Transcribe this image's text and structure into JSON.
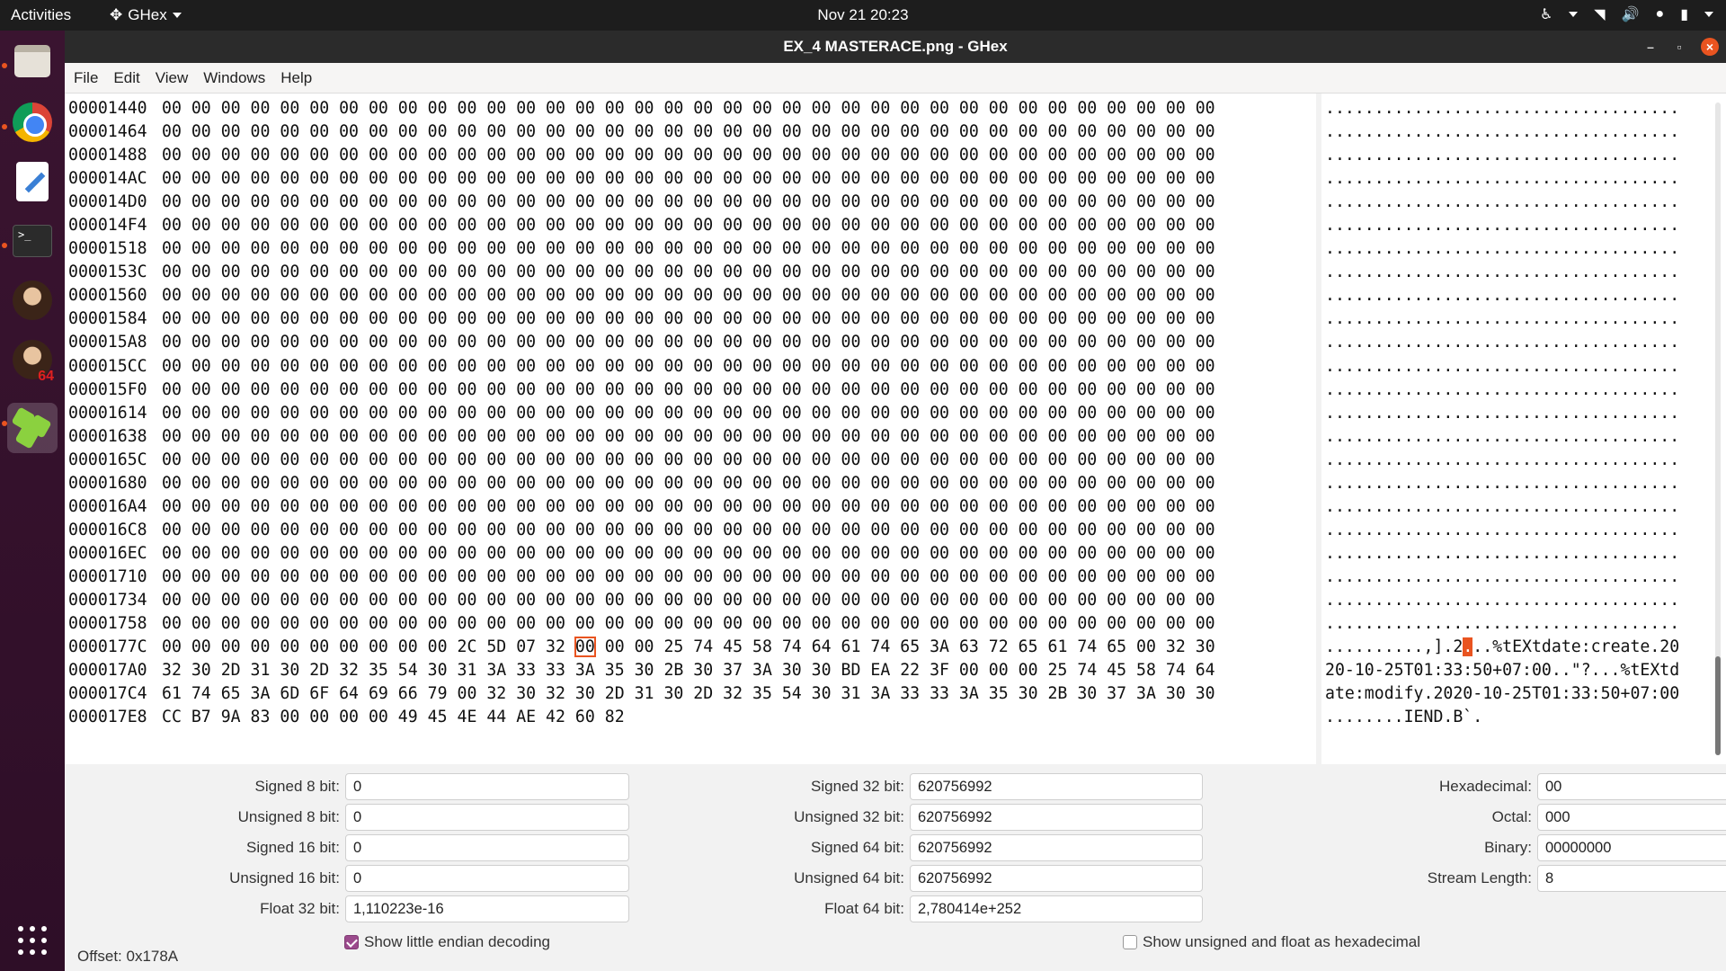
{
  "topbar": {
    "activities": "Activities",
    "app_name": "GHex",
    "clock": "Nov 21  20:23",
    "tray_icons": [
      "accessibility-icon",
      "network-wifi-icon",
      "volume-icon",
      "microphone-icon",
      "battery-icon",
      "system-menu-icon"
    ]
  },
  "dock": {
    "items": [
      "files-icon",
      "chrome-icon",
      "text-editor-icon",
      "terminal-icon",
      "wine-icon",
      "wine64-icon",
      "ghex-icon"
    ],
    "wine64_badge": "64",
    "show_apps": "show-applications-icon"
  },
  "window": {
    "title": "EX_4 MASTERACE.png - GHex",
    "menu": [
      "File",
      "Edit",
      "View",
      "Windows",
      "Help"
    ]
  },
  "hex": {
    "offsets": [
      "00001440",
      "00001464",
      "00001488",
      "000014AC",
      "000014D0",
      "000014F4",
      "00001518",
      "0000153C",
      "00001560",
      "00001584",
      "000015A8",
      "000015CC",
      "000015F0",
      "00001614",
      "00001638",
      "0000165C",
      "00001680",
      "000016A4",
      "000016C8",
      "000016EC",
      "00001710",
      "00001734",
      "00001758",
      "0000177C",
      "000017A0",
      "000017C4",
      "000017E8"
    ],
    "zero_row": "00 00 00 00 00 00 00 00 00 00 00 00 00 00 00 00 00 00 00 00 00 00 00 00 00 00 00 00 00 00 00 00 00 00 00 00",
    "zero_ascii": "....................................",
    "row_177C_pre": "00 00 00 00 00 00 00 00 00 00 2C 5D 07 32 ",
    "row_177C_cursor": "00",
    "row_177C_post": " 00 00 25 74 45 58 74 64 61 74 65 3A 63 72 65 61 74 65 00 32 30",
    "row_17A0": "32 30 2D 31 30 2D 32 35 54 30 31 3A 33 33 3A 35 30 2B 30 37 3A 30 30 BD EA 22 3F 00 00 00 25 74 45 58 74 64",
    "row_17C4": "61 74 65 3A 6D 6F 64 69 66 79 00 32 30 32 30 2D 31 30 2D 32 35 54 30 31 3A 33 33 3A 35 30 2B 30 37 3A 30 30",
    "row_17E8": "CC B7 9A 83 00 00 00 00 49 45 4E 44 AE 42 60 82",
    "ascii_177C_pre": "..........,].2",
    "ascii_177C_cursor": ".",
    "ascii_177C_post": "..%tEXtdate:create.20",
    "ascii_17A0": "20-10-25T01:33:50+07:00..\"?...%tEXtd",
    "ascii_17C4": "ate:modify.2020-10-25T01:33:50+07:00",
    "ascii_17E8": "........IEND.B`."
  },
  "panel": {
    "signed8_label": "Signed 8 bit:",
    "signed8": "0",
    "unsigned8_label": "Unsigned 8 bit:",
    "unsigned8": "0",
    "signed16_label": "Signed 16 bit:",
    "signed16": "0",
    "unsigned16_label": "Unsigned 16 bit:",
    "unsigned16": "0",
    "float32_label": "Float 32 bit:",
    "float32": "1,110223e-16",
    "signed32_label": "Signed 32 bit:",
    "signed32": "620756992",
    "unsigned32_label": "Unsigned 32 bit:",
    "unsigned32": "620756992",
    "signed64_label": "Signed 64 bit:",
    "signed64": "620756992",
    "unsigned64_label": "Unsigned 64 bit:",
    "unsigned64": "620756992",
    "float64_label": "Float 64 bit:",
    "float64": "2,780414e+252",
    "hex_label": "Hexadecimal:",
    "hex": "00",
    "octal_label": "Octal:",
    "octal": "000",
    "binary_label": "Binary:",
    "binary": "00000000",
    "stream_label": "Stream Length:",
    "stream": "8",
    "little_endian_label": "Show little endian decoding",
    "little_endian": true,
    "unsigned_hex_label": "Show unsigned and float as hexadecimal",
    "unsigned_hex": false,
    "stepper_minus": "−",
    "stepper_plus": "+"
  },
  "status": {
    "offset": "Offset: 0x178A"
  },
  "colors": {
    "accent": "#e95420",
    "dock": "#2e0e27",
    "checkbox": "#9b4a8c"
  }
}
